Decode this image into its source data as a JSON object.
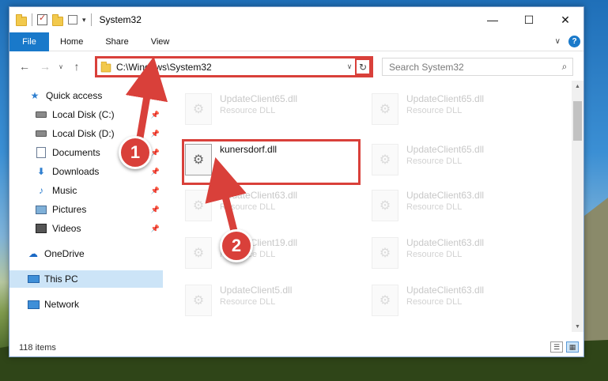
{
  "window": {
    "title": "System32",
    "controls": {
      "minimize": "—",
      "maximize": "☐",
      "close": "✕"
    }
  },
  "ribbon": {
    "tabs": [
      "File",
      "Home",
      "Share",
      "View"
    ],
    "help": "?"
  },
  "nav": {
    "back": "←",
    "forward": "→",
    "recent": "∨",
    "up": "↑",
    "address": "C:\\Windows\\System32",
    "refresh": "↻",
    "search_placeholder": "Search System32",
    "search_icon": "⌕"
  },
  "sidebar": {
    "items": [
      {
        "label": "Quick access",
        "icon": "star-icon",
        "pinned": false
      },
      {
        "label": "Local Disk (C:)",
        "icon": "drive-icon",
        "pinned": true
      },
      {
        "label": "Local Disk (D:)",
        "icon": "drive-icon",
        "pinned": true
      },
      {
        "label": "Documents",
        "icon": "documents-icon",
        "pinned": true
      },
      {
        "label": "Downloads",
        "icon": "downloads-icon",
        "pinned": true
      },
      {
        "label": "Music",
        "icon": "music-icon",
        "pinned": true
      },
      {
        "label": "Pictures",
        "icon": "pictures-icon",
        "pinned": true
      },
      {
        "label": "Videos",
        "icon": "videos-icon",
        "pinned": true
      },
      {
        "label": "OneDrive",
        "icon": "onedrive-icon",
        "pinned": false
      },
      {
        "label": "This PC",
        "icon": "this-pc-icon",
        "pinned": false,
        "selected": true
      },
      {
        "label": "Network",
        "icon": "network-icon",
        "pinned": false
      }
    ]
  },
  "files": [
    {
      "name": "UpdateClient65.dll",
      "type": "Resource DLL"
    },
    {
      "name": "UpdateClient65.dll",
      "type": "Resource DLL"
    },
    {
      "name": "kunersdorf.dll",
      "type": ""
    },
    {
      "name": "UpdateClient65.dll",
      "type": "Resource DLL"
    },
    {
      "name": "UpdateClient63.dll",
      "type": "Resource DLL"
    },
    {
      "name": "UpdateClient63.dll",
      "type": "Resource DLL"
    },
    {
      "name": "UpdateClient19.dll",
      "type": "Resource DLL"
    },
    {
      "name": "UpdateClient63.dll",
      "type": "Resource DLL"
    },
    {
      "name": "UpdateClient5.dll",
      "type": "Resource DLL"
    },
    {
      "name": "UpdateClient63.dll",
      "type": "Resource DLL"
    }
  ],
  "status": {
    "item_count": "118 items"
  },
  "annotations": {
    "step1": "1",
    "step2": "2",
    "color": "#d9403a"
  }
}
